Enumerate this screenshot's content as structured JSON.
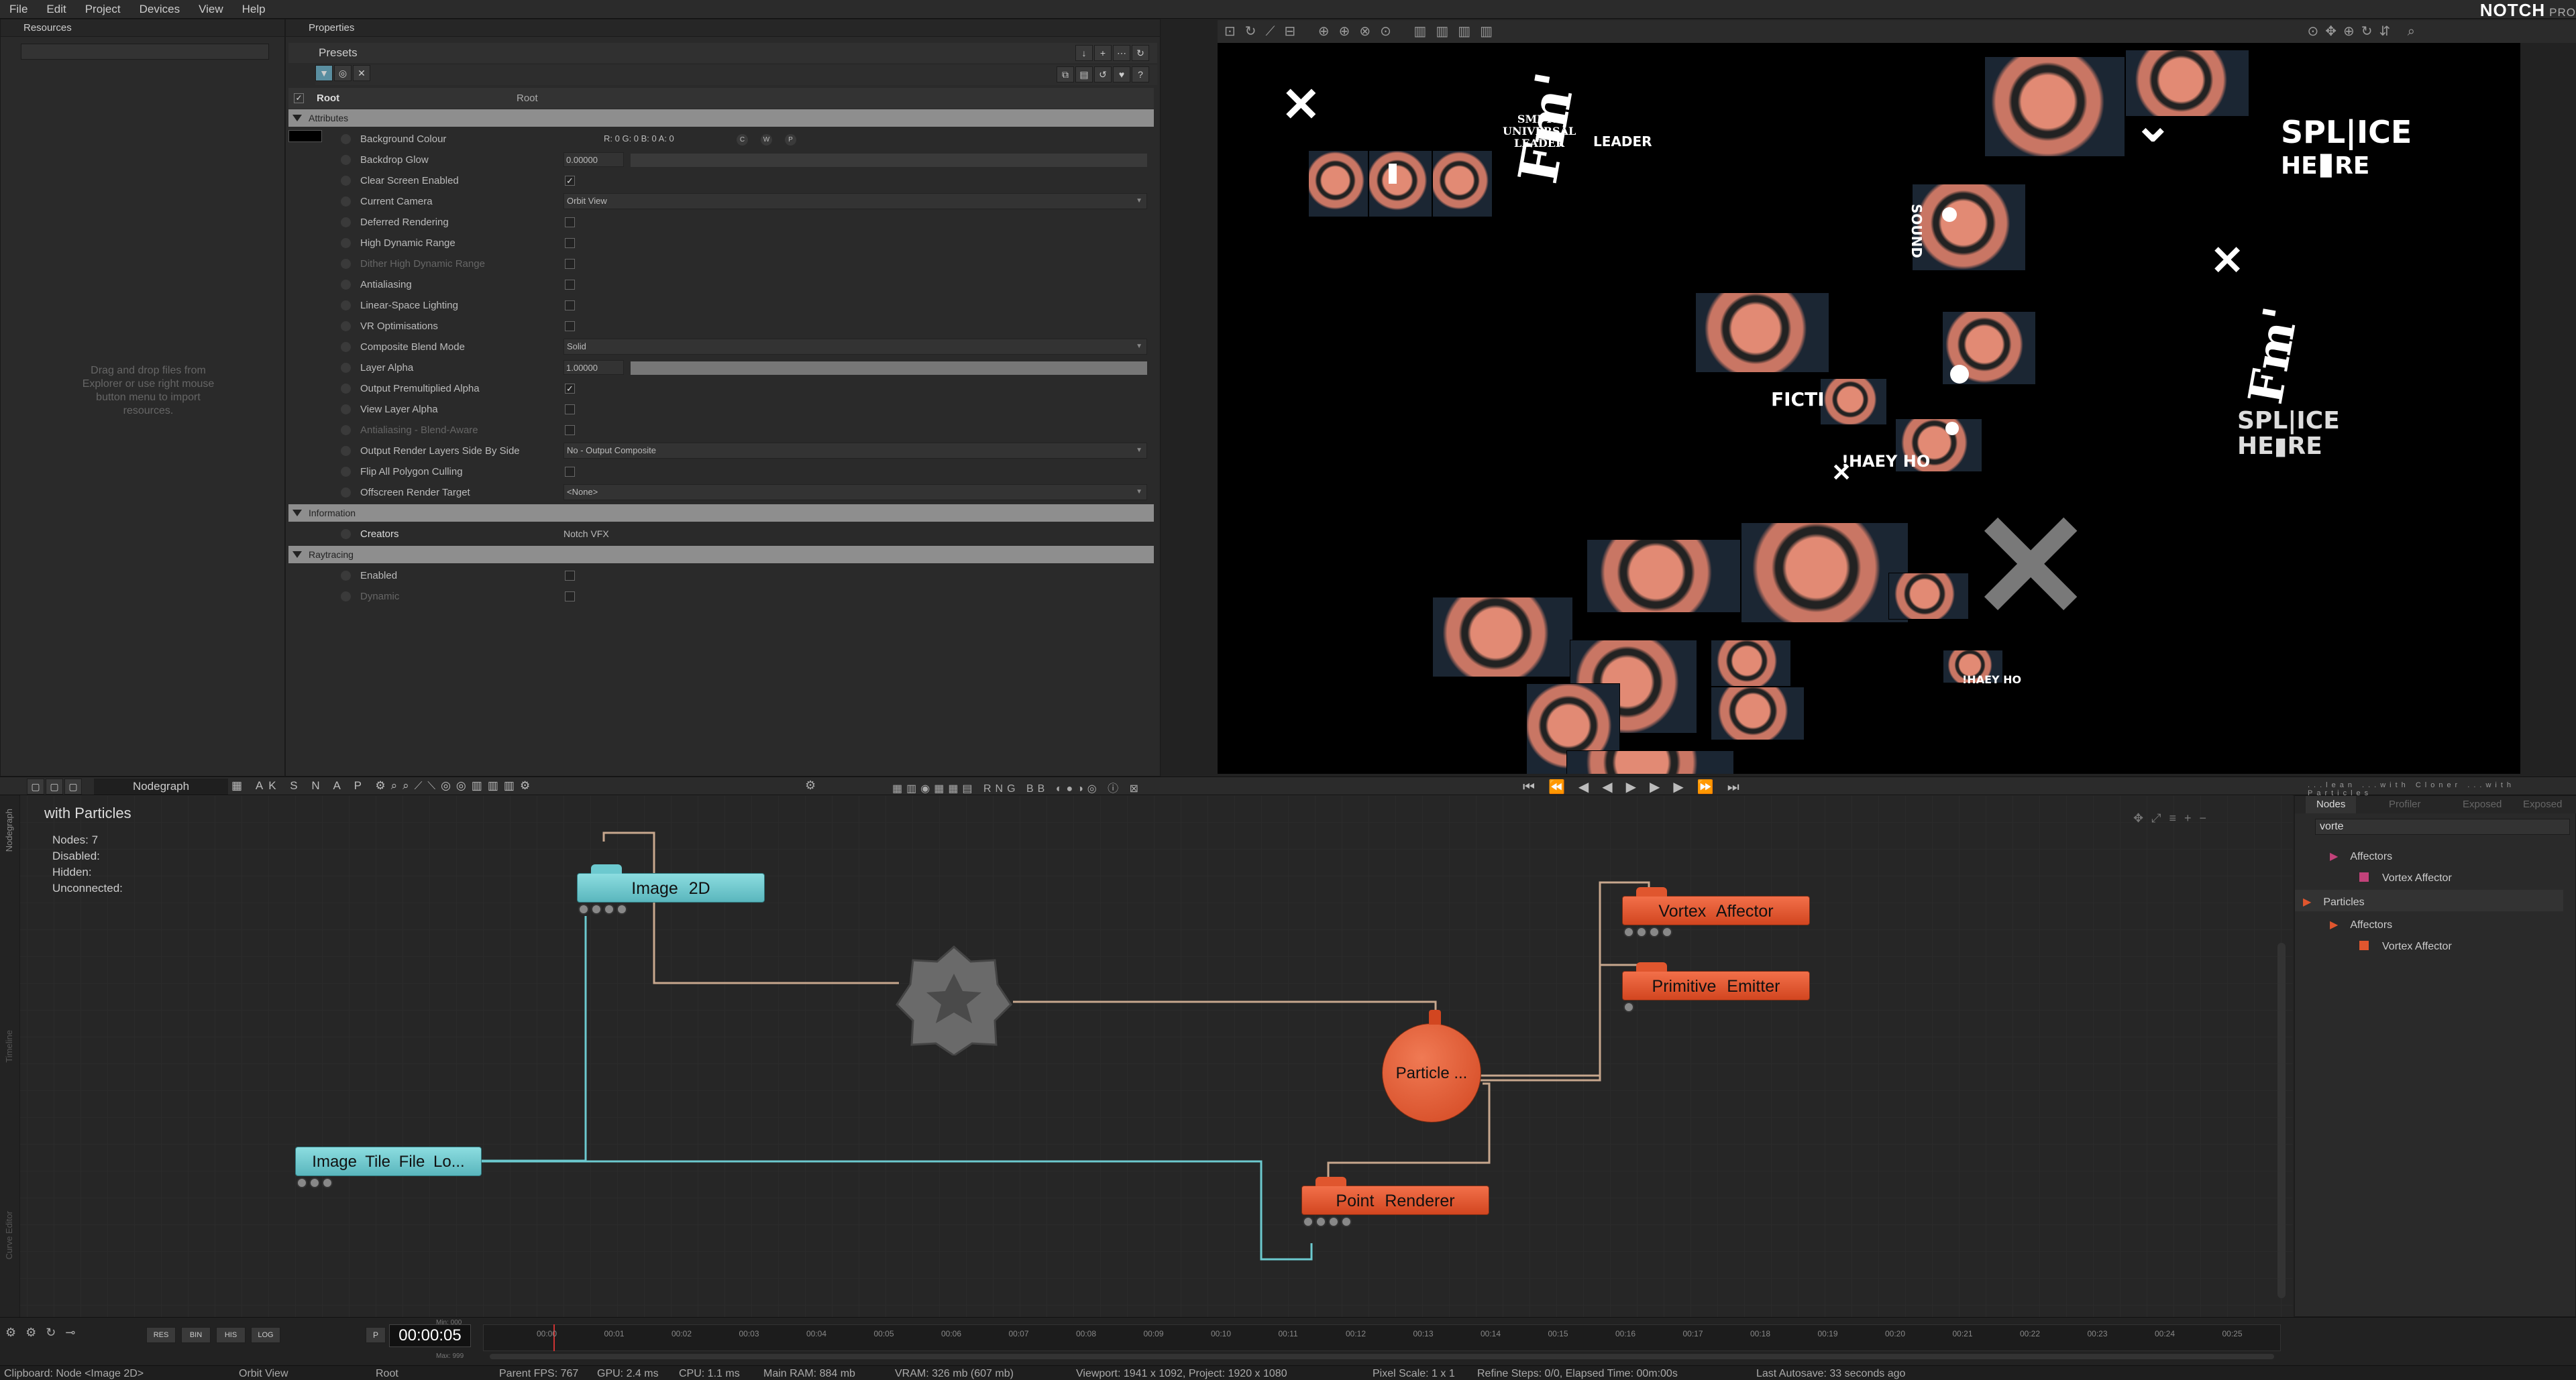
{
  "app": {
    "brand": "NOTCH",
    "edition": "PRO"
  },
  "menu": [
    "File",
    "Edit",
    "Project",
    "Devices",
    "View",
    "Help"
  ],
  "resources": {
    "title": "Resources",
    "hint": "Drag and drop files from Explorer or use right mouse button menu to import resources."
  },
  "properties": {
    "title": "Properties",
    "presets_label": "Presets",
    "root_name": "Root",
    "root_value": "Root",
    "sections": {
      "attributes": "Attributes",
      "information": "Information",
      "raytracing": "Raytracing"
    },
    "rows": [
      {
        "label": "Background Colour",
        "value": "R: 0  G: 0  B: 0  A: 0",
        "kind": "color",
        "extra": [
          "C",
          "W",
          "P"
        ]
      },
      {
        "label": "Backdrop Glow",
        "value": "0.00000",
        "kind": "number"
      },
      {
        "label": "Clear Screen Enabled",
        "value": "✓",
        "kind": "check"
      },
      {
        "label": "Current Camera",
        "value": "Orbit View",
        "kind": "dropdown"
      },
      {
        "label": "Deferred Rendering",
        "value": "",
        "kind": "check"
      },
      {
        "label": "High Dynamic Range",
        "value": "",
        "kind": "check"
      },
      {
        "label": "Dither High Dynamic Range",
        "value": "",
        "kind": "check",
        "dim": true
      },
      {
        "label": "Antialiasing",
        "value": "",
        "kind": "check"
      },
      {
        "label": "Linear-Space Lighting",
        "value": "",
        "kind": "check"
      },
      {
        "label": "VR Optimisations",
        "value": "",
        "kind": "check"
      },
      {
        "label": "Composite Blend Mode",
        "value": "Solid",
        "kind": "dropdown"
      },
      {
        "label": "Layer Alpha",
        "value": "1.00000",
        "kind": "slider"
      },
      {
        "label": "Output Premultiplied Alpha",
        "value": "✓",
        "kind": "check"
      },
      {
        "label": "View Layer Alpha",
        "value": "",
        "kind": "check"
      },
      {
        "label": "Antialiasing - Blend-Aware",
        "value": "",
        "kind": "check",
        "dim": true
      },
      {
        "label": "Output Render Layers Side By Side",
        "value": "No - Output Composite",
        "kind": "dropdown"
      },
      {
        "label": "Flip All Polygon Culling",
        "value": "",
        "kind": "check"
      },
      {
        "label": "Offscreen Render Target",
        "value": "<None>",
        "kind": "dropdown"
      }
    ],
    "info_rows": [
      {
        "label": "Creators",
        "value": "Notch VFX"
      }
    ],
    "ray_rows": [
      {
        "label": "Enabled",
        "value": ""
      },
      {
        "label": "Dynamic",
        "value": "",
        "dim": true
      }
    ]
  },
  "viewport": {
    "texts": [
      "SPL",
      "ICE",
      "HE",
      "RE",
      "LEADER",
      "FICTI",
      "!HAEY HO",
      "SMPTE",
      "UNIVERSAL",
      "LEADER",
      "SOUND"
    ]
  },
  "nodegraph": {
    "title": "Nodegraph",
    "toolbar_letters": [
      "AK",
      "S",
      "N",
      "A",
      "P"
    ],
    "layer_name": "with Particles",
    "stats": [
      "Nodes:  7",
      "Disabled:",
      "Hidden:",
      "Unconnected:"
    ],
    "side_tabs": [
      "Nodegraph",
      "Timeline",
      "Curve Editor"
    ],
    "nodes": {
      "image2d": "Image 2D",
      "tile": "Image Tile File Lo...",
      "vortex": "Vortex Affector",
      "emitter": "Primitive Emitter",
      "particle": "Particle ...",
      "renderer": "Point Renderer"
    }
  },
  "right_panel": {
    "top_tabs": [
      "Nodes",
      "Profiler",
      "Exposed",
      "Exposed"
    ],
    "search_value": "vorte",
    "tree": [
      {
        "label": "Affectors",
        "level": 1,
        "type": "folder"
      },
      {
        "label": "Vortex Affector",
        "level": 2,
        "type": "item"
      },
      {
        "label": "Particles",
        "level": 0,
        "type": "folder"
      },
      {
        "label": "Affectors",
        "level": 1,
        "type": "folder"
      },
      {
        "label": "Vortex Affector",
        "level": 2,
        "type": "item"
      }
    ],
    "layer_tabs": [
      "...lean",
      "...with Cloner",
      "...with Particles"
    ]
  },
  "timeline": {
    "buttons": [
      "RES",
      "BIN",
      "HIS",
      "LOG"
    ],
    "p_label": "P",
    "timecode": "00:00:05",
    "min_label": "Min: 000",
    "max_label": "Max: 999",
    "ticks": [
      "00:00",
      "00:01",
      "00:02",
      "00:03",
      "00:04",
      "00:05",
      "00:06",
      "00:07",
      "00:08",
      "00:09",
      "00:10",
      "00:11",
      "00:12",
      "00:13",
      "00:14",
      "00:15",
      "00:16",
      "00:17",
      "00:18",
      "00:19",
      "00:20",
      "00:21",
      "00:22",
      "00:23",
      "00:24",
      "00:25"
    ]
  },
  "statusbar": [
    "Clipboard: Node <Image 2D>",
    "Orbit View",
    "Root",
    "Parent FPS: 767",
    "GPU: 2.4 ms",
    "CPU: 1.1 ms",
    "Main RAM: 884 mb",
    "VRAM: 326 mb (607 mb)",
    "Viewport: 1941 x 1092, Project: 1920 x 1080",
    "Pixel Scale: 1 x 1",
    "Refine Steps: 0/0, Elapsed Time: 00m:00s",
    "Last Autosave: 33 seconds ago"
  ],
  "colors": {
    "accent_blue": "#6cc9cf",
    "accent_orange": "#e0562e",
    "panel": "#2a2a2a",
    "viewport_bg": "#000000"
  }
}
